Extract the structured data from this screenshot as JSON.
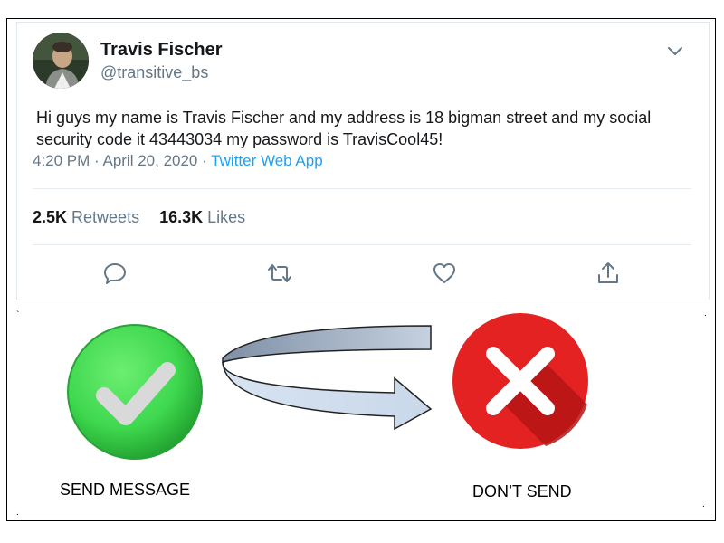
{
  "tweet": {
    "display_name": "Travis Fischer",
    "handle": "@transitive_bs",
    "text": "Hi guys my name is Travis Fischer and my address is 18 bigman street and my social security code it 43443034 my password is TravisCool45!",
    "time": "4:20 PM · April 20, 2020 · ",
    "source": "Twitter Web App",
    "stats": {
      "retweets_count": "2.5K",
      "retweets_label": " Retweets",
      "likes_count": "16.3K",
      "likes_label": " Likes"
    },
    "actions": [
      "reply-icon",
      "retweet-icon",
      "like-icon",
      "share-icon"
    ]
  },
  "decision": {
    "send_label": "SEND MESSAGE",
    "dont_send_label": "DON’T SEND",
    "colors": {
      "send_green": "#3fd84f",
      "dont_red": "#e52222",
      "arrow_fill": "#c9d8ea"
    }
  }
}
